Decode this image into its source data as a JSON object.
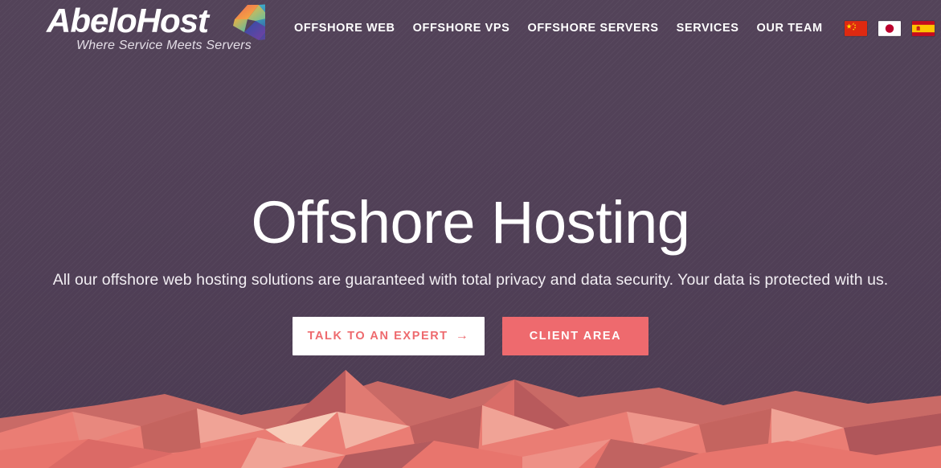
{
  "brand": {
    "name": "AbeloHost",
    "tagline": "Where Service Meets Servers",
    "logo_icon": "origami-bird-icon"
  },
  "nav": {
    "items": [
      {
        "label": "OFFSHORE WEB",
        "name": "nav-item-offshore-web"
      },
      {
        "label": "OFFSHORE VPS",
        "name": "nav-item-offshore-vps"
      },
      {
        "label": "OFFSHORE SERVERS",
        "name": "nav-item-offshore-servers"
      },
      {
        "label": "SERVICES",
        "name": "nav-item-services"
      },
      {
        "label": "OUR TEAM",
        "name": "nav-item-our-team"
      }
    ],
    "flags": [
      {
        "name": "flag-china-icon",
        "title": "China"
      },
      {
        "name": "flag-japan-icon",
        "title": "Japan"
      },
      {
        "name": "flag-spain-icon",
        "title": "Spain"
      }
    ]
  },
  "hero": {
    "title": "Offshore Hosting",
    "subtitle": "All our offshore web hosting solutions are guaranteed with total privacy and data security. Your data is protected with us.",
    "primary_button": {
      "label": "TALK TO AN EXPERT",
      "arrow": "→"
    },
    "secondary_button": {
      "label": "CLIENT AREA"
    }
  },
  "colors": {
    "background_top": "#534359",
    "background_bottom": "#4b3b52",
    "accent_coral": "#ee6a6e",
    "text_light": "#ffffff",
    "mountain_light": "#f0a396",
    "mountain_mid": "#ea7d74",
    "mountain_dark": "#b85a5c"
  }
}
